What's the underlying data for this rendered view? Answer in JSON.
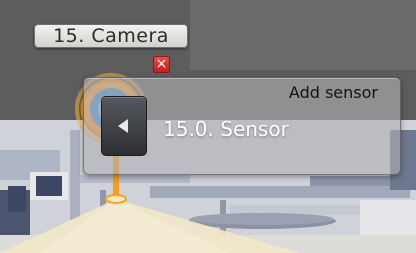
{
  "camera": {
    "tag_label": "15. Camera",
    "close_icon": "close-icon",
    "marker_color": "#f29a21"
  },
  "panel": {
    "title": "Add sensor",
    "back_icon": "chevron-left-icon",
    "sensor_label": "15.0. Sensor"
  }
}
